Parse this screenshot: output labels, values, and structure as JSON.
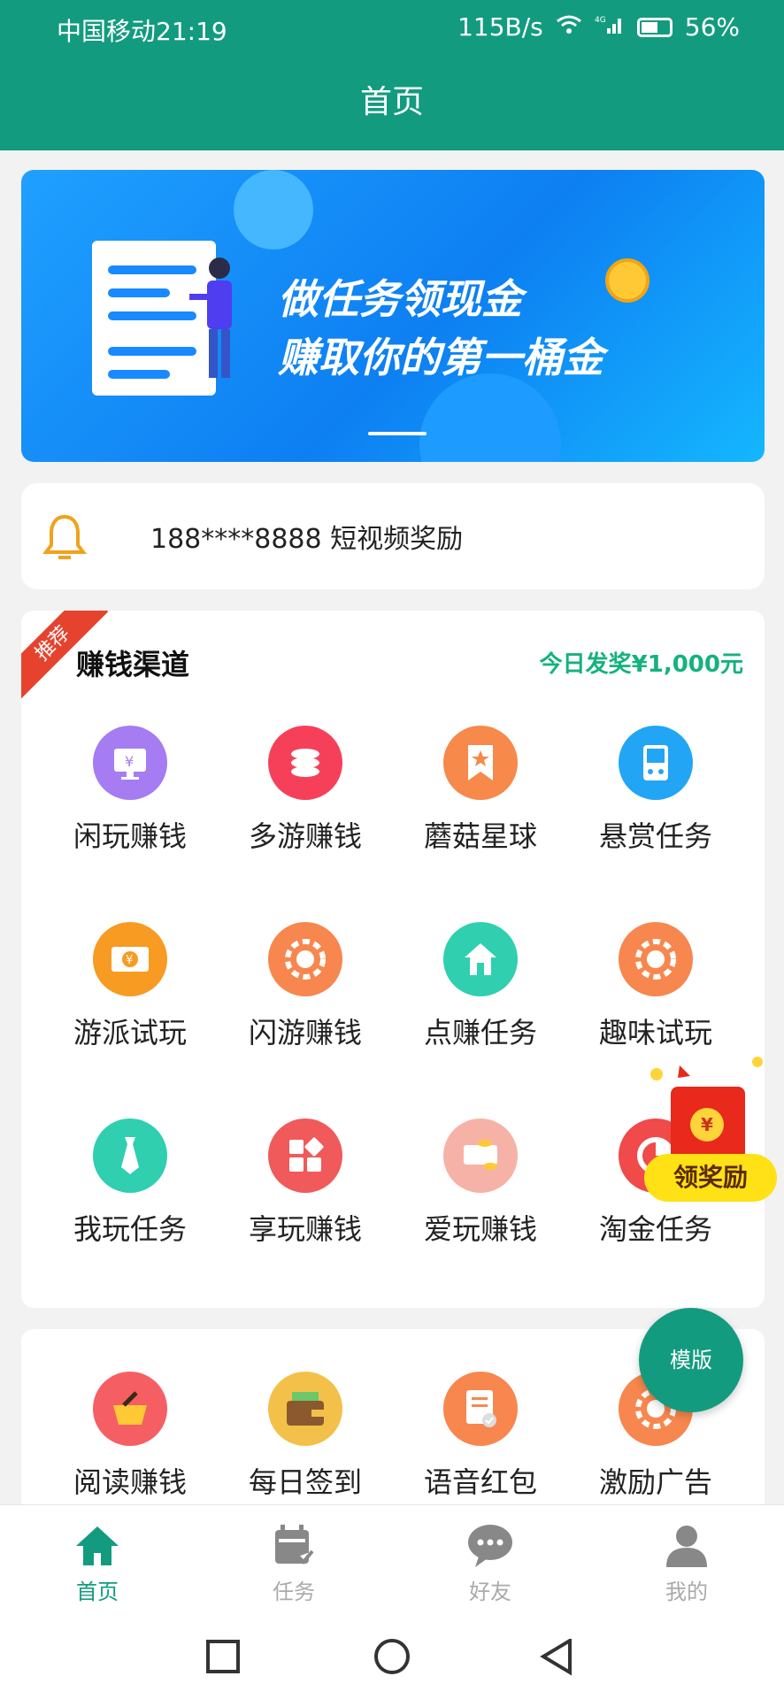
{
  "status": {
    "carrier_time": "中国移动21:19",
    "speed": "115B/s",
    "signal": "4G",
    "battery": "56%"
  },
  "header": {
    "title": "首页"
  },
  "banner": {
    "line1": "做任务领现金",
    "line2": "赚取你的第一桶金"
  },
  "notice": {
    "text": "188****8888 短视频奖励",
    "icon": "bell-icon"
  },
  "channels": {
    "badge": "推荐",
    "title": "赚钱渠道",
    "payout": "今日发奖¥1,000元",
    "items": [
      {
        "label": "闲玩赚钱",
        "icon": "monitor-yen-icon",
        "color": "#a57cf2"
      },
      {
        "label": "多游赚钱",
        "icon": "coin-stack-icon",
        "color": "#f6405a"
      },
      {
        "label": "蘑菇星球",
        "icon": "bookmark-star-icon",
        "color": "#f7894a"
      },
      {
        "label": "悬赏任务",
        "icon": "handheld-icon",
        "color": "#23a5f6"
      },
      {
        "label": "游派试玩",
        "icon": "yen-card-icon",
        "color": "#f79b22"
      },
      {
        "label": "闪游赚钱",
        "icon": "chip-icon",
        "color": "#f7874e"
      },
      {
        "label": "点赚任务",
        "icon": "house-icon",
        "color": "#2fcfb0"
      },
      {
        "label": "趣味试玩",
        "icon": "chip-icon",
        "color": "#f7874e"
      },
      {
        "label": "我玩任务",
        "icon": "tie-icon",
        "color": "#2fcfb0"
      },
      {
        "label": "享玩赚钱",
        "icon": "apps-icon",
        "color": "#f05a5a"
      },
      {
        "label": "爱玩赚钱",
        "icon": "cash-icon",
        "color": "#f7b2a8"
      },
      {
        "label": "淘金任务",
        "icon": "pie-icon",
        "color": "#f04a4a"
      }
    ]
  },
  "tools": {
    "items": [
      {
        "label": "阅读赚钱",
        "icon": "basket-icon",
        "color": "#f55f63"
      },
      {
        "label": "每日签到",
        "icon": "wallet-icon",
        "color": "#f3c04a"
      },
      {
        "label": "语音红包",
        "icon": "document-icon",
        "color": "#f7874e"
      },
      {
        "label": "激励广告",
        "icon": "chip-icon",
        "color": "#f7874e"
      }
    ]
  },
  "float_reward": {
    "coin": "¥",
    "label": "领奖励"
  },
  "fab": {
    "label": "模版"
  },
  "tabbar": [
    {
      "label": "首页",
      "icon": "home-icon",
      "active": true
    },
    {
      "label": "任务",
      "icon": "calendar-check-icon",
      "active": false
    },
    {
      "label": "好友",
      "icon": "chat-bubble-icon",
      "active": false
    },
    {
      "label": "我的",
      "icon": "person-icon",
      "active": false
    }
  ],
  "colors": {
    "primary": "#139b7f",
    "accent_green": "#15b27c",
    "ribbon": "#e5432e"
  }
}
